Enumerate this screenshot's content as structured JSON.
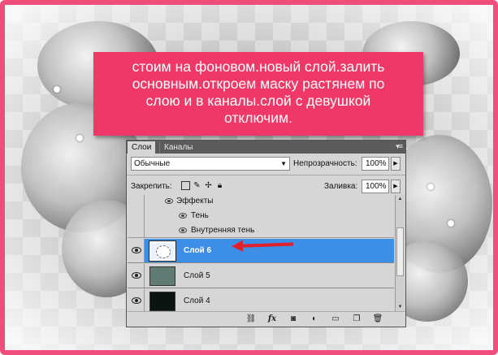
{
  "banner": {
    "lines": [
      "стоим на фоновом.новый слой.залить",
      "основным.откроем маску растянем по",
      "слою и в каналы.слой с девушкой",
      "отключим."
    ]
  },
  "panel": {
    "tabs": [
      "Слои",
      "Каналы"
    ],
    "menu_icon": "panel-menu-icon",
    "blend_mode": "Обычные",
    "opacity_label": "Непрозрачность:",
    "opacity_value": "100%",
    "lock_label": "Закрепить:",
    "fill_label": "Заливка:",
    "fill_value": "100%",
    "effects": {
      "label": "Эффекты",
      "items": [
        "Тень",
        "Внутренняя тень"
      ]
    },
    "layers": [
      {
        "name": "Слой 6",
        "selected": true,
        "thumb": "white-blob"
      },
      {
        "name": "Слой 5",
        "selected": false,
        "thumb": "#5f7b74"
      },
      {
        "name": "Слой 4",
        "selected": false,
        "thumb": "#0c1412"
      }
    ],
    "footer_icons": [
      "link-icon",
      "fx-icon",
      "mask-icon",
      "adjustment-icon",
      "folder-icon",
      "new-layer-icon",
      "trash-icon"
    ],
    "fx_text": "fx"
  },
  "colors": {
    "banner": "#ef3867",
    "border": "#ef4e7c",
    "selected_row": "#3d8ee6",
    "arrow": "#e0202a"
  }
}
